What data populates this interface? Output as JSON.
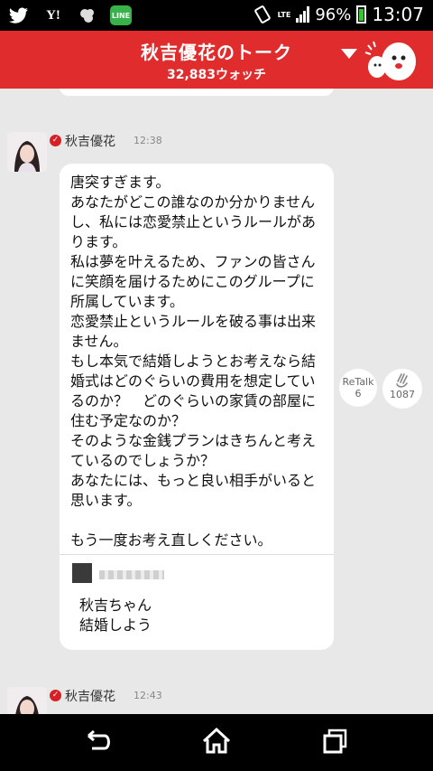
{
  "status_bar": {
    "icons": [
      "twitter-icon",
      "yahoo-icon",
      "leaf-icon",
      "line-icon"
    ],
    "yahoo_label": "Y!",
    "line_label": "LINE",
    "network": "LTE",
    "battery": "96%",
    "time": "13:07"
  },
  "header": {
    "title": "秋吉優花のトーク",
    "watch_count": "32,883ウォッチ"
  },
  "messages": [
    {
      "sender": "秋吉優花",
      "time": "12:38",
      "body": "唐突すぎます。\nあなたがどこの誰なのか分かりませんし、私には恋愛禁止というルールがあります。\n私は夢を叶えるため、ファンの皆さんに笑顔を届けるためにこのグループに所属しています。\n恋愛禁止というルールを破る事は出来ません。\nもし本気で結婚しようとお考えなら結婚式はどのぐらいの費用を想定しているのか？　どのぐらいの家賃の部屋に住む予定なのか？\nそのような金銭プランはきちんと考えているのでしょうか？\nあなたには、もっと良い相手がいると思います。\n\nもう一度お考え直しください。",
      "quoted_reply": "秋吉ちゃん\n結婚しよう",
      "retalk_label": "ReTalk",
      "retalk_count": "6",
      "like_count": "1087"
    },
    {
      "sender": "秋吉優花",
      "time": "12:43"
    }
  ],
  "colors": {
    "brand_red": "#e02c2c",
    "verified_red": "#d81f26",
    "background": "#e8e8e8"
  }
}
